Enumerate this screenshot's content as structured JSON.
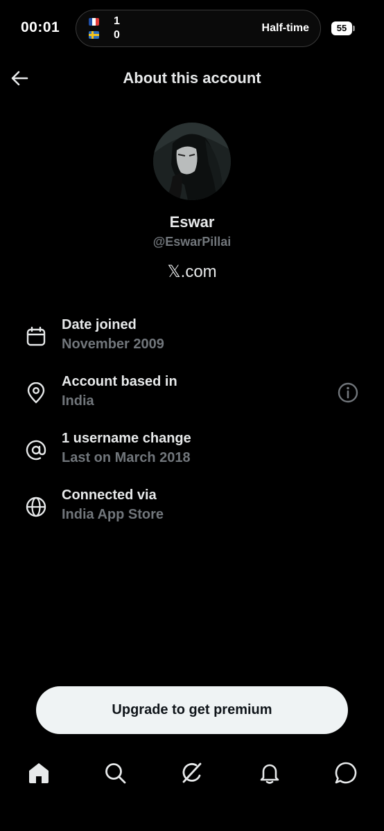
{
  "status_bar": {
    "time": "00:01",
    "battery": "55",
    "live_match": {
      "home_flag": "flag-france",
      "away_flag": "flag-sweden",
      "home_score": "1",
      "away_score": "0",
      "status": "Half-time"
    }
  },
  "header": {
    "title": "About this account",
    "back_icon": "arrow-left-icon"
  },
  "profile": {
    "name": "Eswar",
    "handle": "@EswarPillai",
    "site": "𝕏.com"
  },
  "details": [
    {
      "icon": "calendar-icon",
      "title": "Date joined",
      "value": "November 2009"
    },
    {
      "icon": "location-pin-icon",
      "title": "Account based in",
      "value": "India",
      "extra_icon": "info-icon"
    },
    {
      "icon": "at-sign-icon",
      "title": "1 username change",
      "value": "Last on March 2018"
    },
    {
      "icon": "globe-icon",
      "title": "Connected via",
      "value": "India App Store"
    }
  ],
  "upgrade": {
    "label": "Upgrade to get premium"
  },
  "bottom_nav": [
    "home-icon",
    "search-icon",
    "grok-icon",
    "notifications-icon",
    "messages-icon"
  ],
  "colors": {
    "background": "#000000",
    "primary_text": "#e7e9ea",
    "secondary_text": "#71767b",
    "button_bg": "#eff3f4",
    "button_text": "#0f1419"
  }
}
